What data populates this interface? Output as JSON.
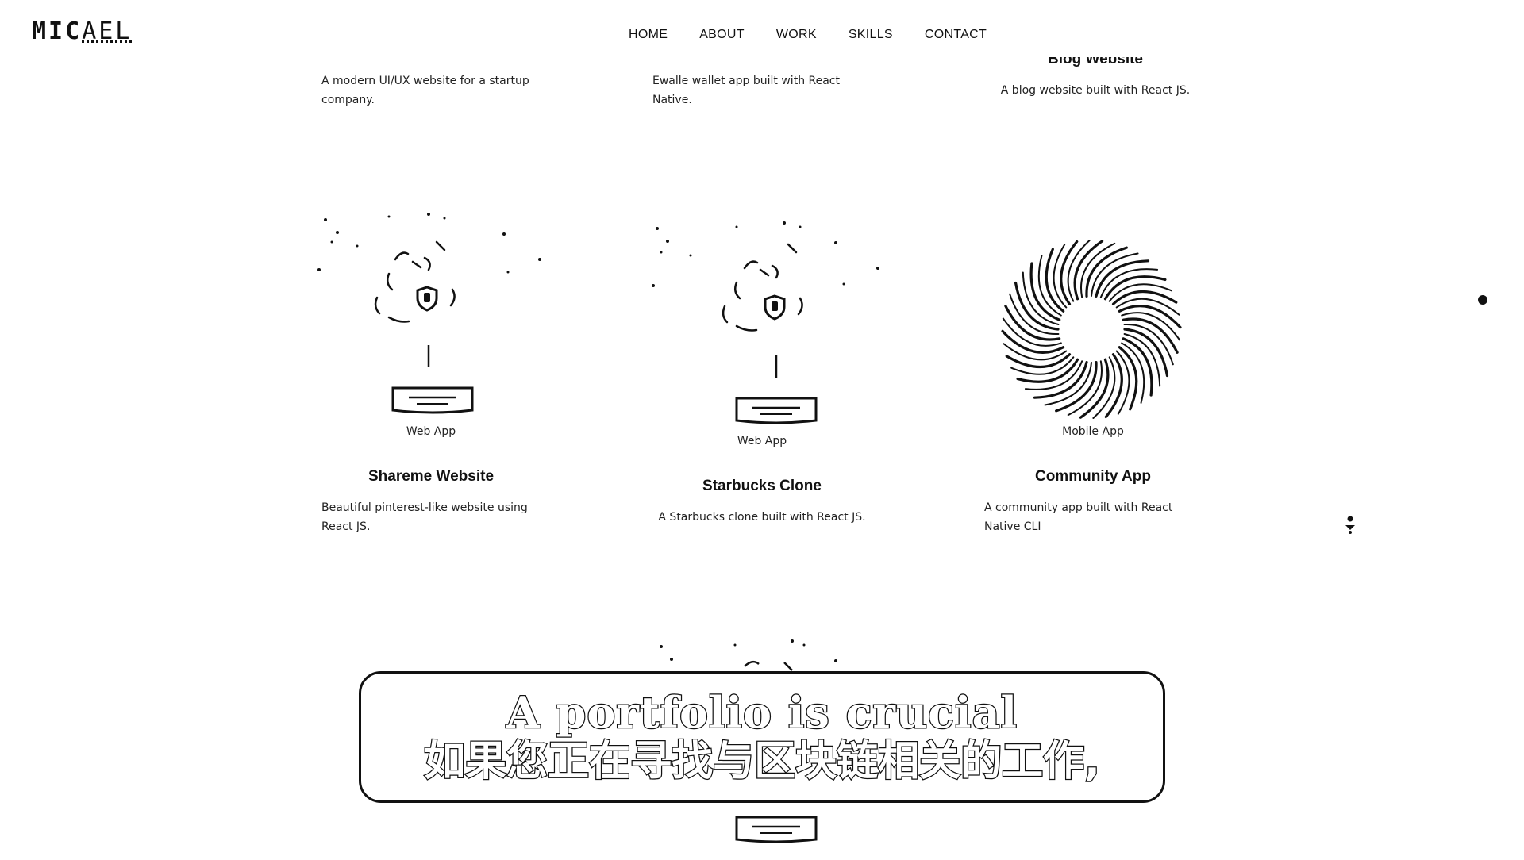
{
  "logo": {
    "part1": "MIC",
    "part2": "AEL"
  },
  "nav": [
    "HOME",
    "ABOUT",
    "WORK",
    "SKILLS",
    "CONTACT"
  ],
  "top_row": [
    {
      "description": "A modern UI/UX website for a startup company."
    },
    {
      "description": "Ewalle wallet app built with React Native."
    },
    {
      "title": "Blog Website",
      "description": "A blog website built with React JS."
    }
  ],
  "projects": [
    {
      "category": "Web App",
      "title": "Shareme Website",
      "description": "Beautiful pinterest-like website using React JS."
    },
    {
      "category": "Web App",
      "title": "Starbucks Clone",
      "description": "A Starbucks clone built with React JS."
    },
    {
      "category": "Mobile App",
      "title": "Community App",
      "description": "A community app built with React Native CLI"
    }
  ],
  "subtitle": {
    "line1": "A portfolio is crucial",
    "line2": "如果您正在寻找与区块链相关的工作,"
  },
  "colors": {
    "background": "#ffffff",
    "text": "#111111"
  },
  "icons": [
    "web-app-illustration",
    "mobile-app-swirl-illustration",
    "scroll-down-icon"
  ]
}
